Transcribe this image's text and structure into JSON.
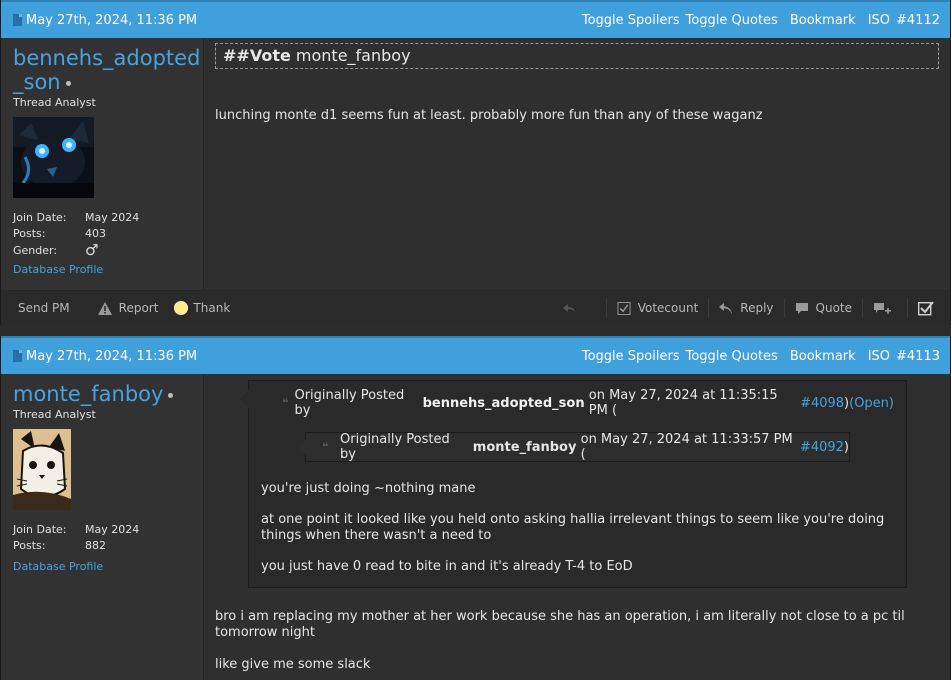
{
  "posts": [
    {
      "date": "May 27th, 2024, 11:36 PM",
      "links": {
        "toggle_spoilers": "Toggle Spoilers",
        "toggle_quotes": "Toggle Quotes",
        "bookmark": "Bookmark",
        "iso": "ISO",
        "post_number": "#4112"
      },
      "user": {
        "name_line1": "bennehs_adopted",
        "name_line2": "_son",
        "title": "Thread Analyst",
        "join_label": "Join Date:",
        "join_value": "May 2024",
        "posts_label": "Posts:",
        "posts_value": "403",
        "gender_label": "Gender:",
        "gender_value": "♂",
        "db_profile": "Database Profile"
      },
      "vote": {
        "tag": "##Vote",
        "target": "monte_fanboy"
      },
      "text": "lunching monte d1 seems fun at least. probably more fun than any of these waganz",
      "footer": {
        "send_pm": "Send PM",
        "report": "Report",
        "thank": "Thank",
        "votecount": "Votecount",
        "reply": "Reply",
        "quote": "Quote"
      }
    },
    {
      "date": "May 27th, 2024, 11:36 PM",
      "links": {
        "toggle_spoilers": "Toggle Spoilers",
        "toggle_quotes": "Toggle Quotes",
        "bookmark": "Bookmark",
        "iso": "ISO",
        "post_number": "#4113"
      },
      "user": {
        "name": "monte_fanboy",
        "title": "Thread Analyst",
        "join_label": "Join Date:",
        "join_value": "May 2024",
        "posts_label": "Posts:",
        "posts_value": "882",
        "db_profile": "Database Profile"
      },
      "quote": {
        "prefix": "Originally Posted by",
        "author": "bennehs_adopted_son",
        "on": "on May 27, 2024 at 11:35:15 PM (",
        "ref": "#4098",
        "close": ")",
        "open": "(Open)",
        "inner": {
          "prefix": "Originally Posted by",
          "author": "monte_fanboy",
          "on": "on May 27, 2024 at 11:33:57 PM (",
          "ref": "#4092",
          "close": ")"
        },
        "lines": [
          "you're just doing ~nothing mane",
          "at one point it looked like you held onto asking hallia irrelevant things to seem like you're doing things when there wasn't a need to",
          "you just have 0 read to bite in and it's already T-4 to EoD"
        ]
      },
      "text1": "bro i am replacing my mother at her work because she has an operation, i am literally not close to a pc til tomorrow night",
      "text2": "like give me some slack"
    }
  ]
}
